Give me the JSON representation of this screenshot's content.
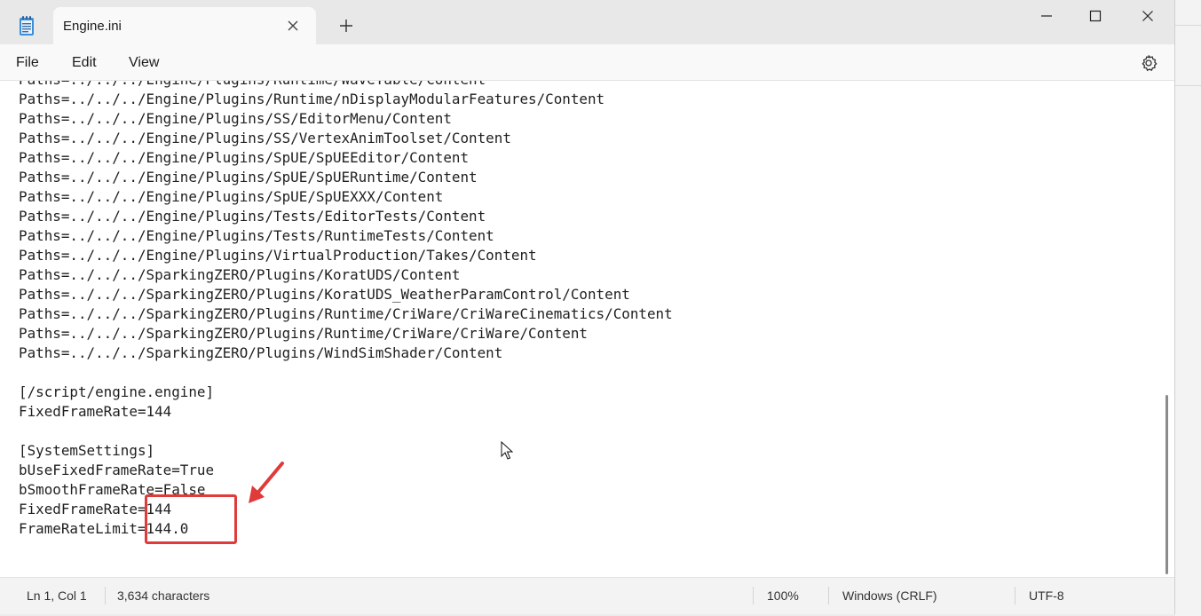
{
  "tab": {
    "title": "Engine.ini"
  },
  "menu": {
    "file": "File",
    "edit": "Edit",
    "view": "View"
  },
  "editor": {
    "lines": [
      "Paths=../../../Engine/Plugins/Runtime/WaveTable/Content",
      "Paths=../../../Engine/Plugins/Runtime/nDisplayModularFeatures/Content",
      "Paths=../../../Engine/Plugins/SS/EditorMenu/Content",
      "Paths=../../../Engine/Plugins/SS/VertexAnimToolset/Content",
      "Paths=../../../Engine/Plugins/SpUE/SpUEEditor/Content",
      "Paths=../../../Engine/Plugins/SpUE/SpUERuntime/Content",
      "Paths=../../../Engine/Plugins/SpUE/SpUEXXX/Content",
      "Paths=../../../Engine/Plugins/Tests/EditorTests/Content",
      "Paths=../../../Engine/Plugins/Tests/RuntimeTests/Content",
      "Paths=../../../Engine/Plugins/VirtualProduction/Takes/Content",
      "Paths=../../../SparkingZERO/Plugins/KoratUDS/Content",
      "Paths=../../../SparkingZERO/Plugins/KoratUDS_WeatherParamControl/Content",
      "Paths=../../../SparkingZERO/Plugins/Runtime/CriWare/CriWareCinematics/Content",
      "Paths=../../../SparkingZERO/Plugins/Runtime/CriWare/CriWare/Content",
      "Paths=../../../SparkingZERO/Plugins/WindSimShader/Content",
      "",
      "[/script/engine.engine]",
      "FixedFrameRate=144",
      "",
      "[SystemSettings]",
      "bUseFixedFrameRate=True",
      "bSmoothFrameRate=False",
      "FixedFrameRate=144",
      "FrameRateLimit=144.0"
    ]
  },
  "status": {
    "position": "Ln 1, Col 1",
    "characters": "3,634 characters",
    "zoom": "100%",
    "line_ending": "Windows (CRLF)",
    "encoding": "UTF-8"
  },
  "colors": {
    "annotation": "#e03a3a"
  }
}
